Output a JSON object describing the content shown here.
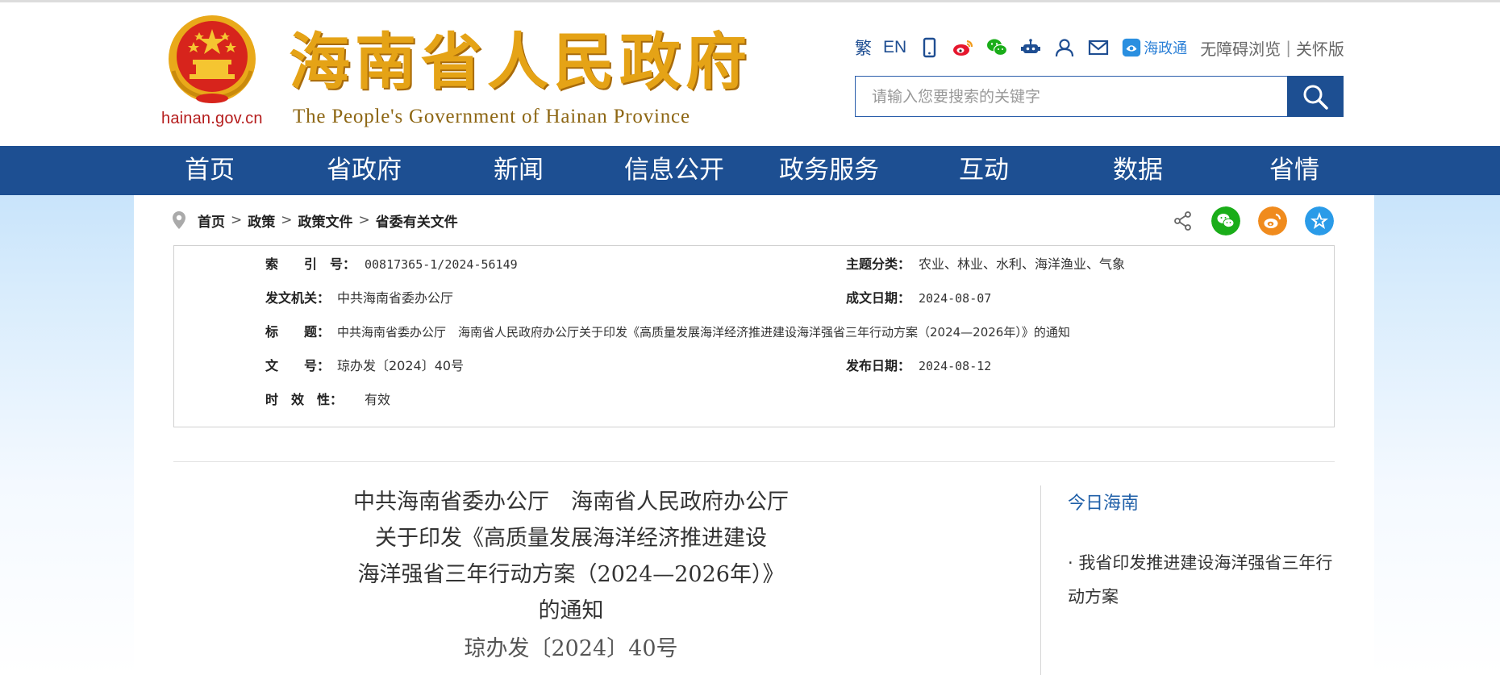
{
  "header": {
    "site_title": "海南省人民政府",
    "site_subtitle": "The People's Government  of Hainan Province",
    "emblem_url": "hainan.gov.cn",
    "tools": {
      "traditional": "繁",
      "english": "EN",
      "app_name": "海政通",
      "accessibility": "无障碍浏览",
      "elderly": "关怀版",
      "separator": "|"
    },
    "search": {
      "placeholder": "请输入您要搜索的关键字",
      "value": ""
    }
  },
  "nav": {
    "items": [
      "首页",
      "省政府",
      "新闻",
      "信息公开",
      "政务服务",
      "互动",
      "数据",
      "省情"
    ]
  },
  "breadcrumb": {
    "items": [
      "首页",
      "政策",
      "政策文件",
      "省委有关文件"
    ],
    "separator": ">"
  },
  "meta": {
    "index_label": "索　　引　号：",
    "index_value": "00817365-1/2024-56149",
    "topic_label": "主题分类：",
    "topic_value": "农业、林业、水利、海洋渔业、气象",
    "issuer_label": "发文机关：",
    "issuer_value": "中共海南省委办公厅",
    "created_label": "成文日期：",
    "created_value": "2024-08-07",
    "title_label": "标　　题：",
    "title_value": "中共海南省委办公厅　海南省人民政府办公厅关于印发《高质量发展海洋经济推进建设海洋强省三年行动方案（2024—2026年）》的通知",
    "docno_label": "文　　号：",
    "docno_value": "琼办发〔2024〕40号",
    "published_label": "发布日期：",
    "published_value": "2024-08-12",
    "validity_label": "时　效　性：",
    "validity_value": "有效"
  },
  "document": {
    "title_lines": [
      "中共海南省委办公厅　海南省人民政府办公厅",
      "关于印发《高质量发展海洋经济推进建设",
      "海洋强省三年行动方案（2024—2026年）》",
      "的通知"
    ],
    "doc_number": "琼办发〔2024〕40号"
  },
  "sidebar": {
    "title": "今日海南",
    "link": "· 我省印发推进建设海洋强省三年行动方案"
  },
  "colors": {
    "nav_bg": "#1d4f92",
    "title_gold": "#e5a316",
    "link_blue": "#1f5fa8",
    "wechat_green": "#1aad19",
    "weibo_orange": "#f08b1d",
    "favorite_blue": "#2a9be8"
  }
}
